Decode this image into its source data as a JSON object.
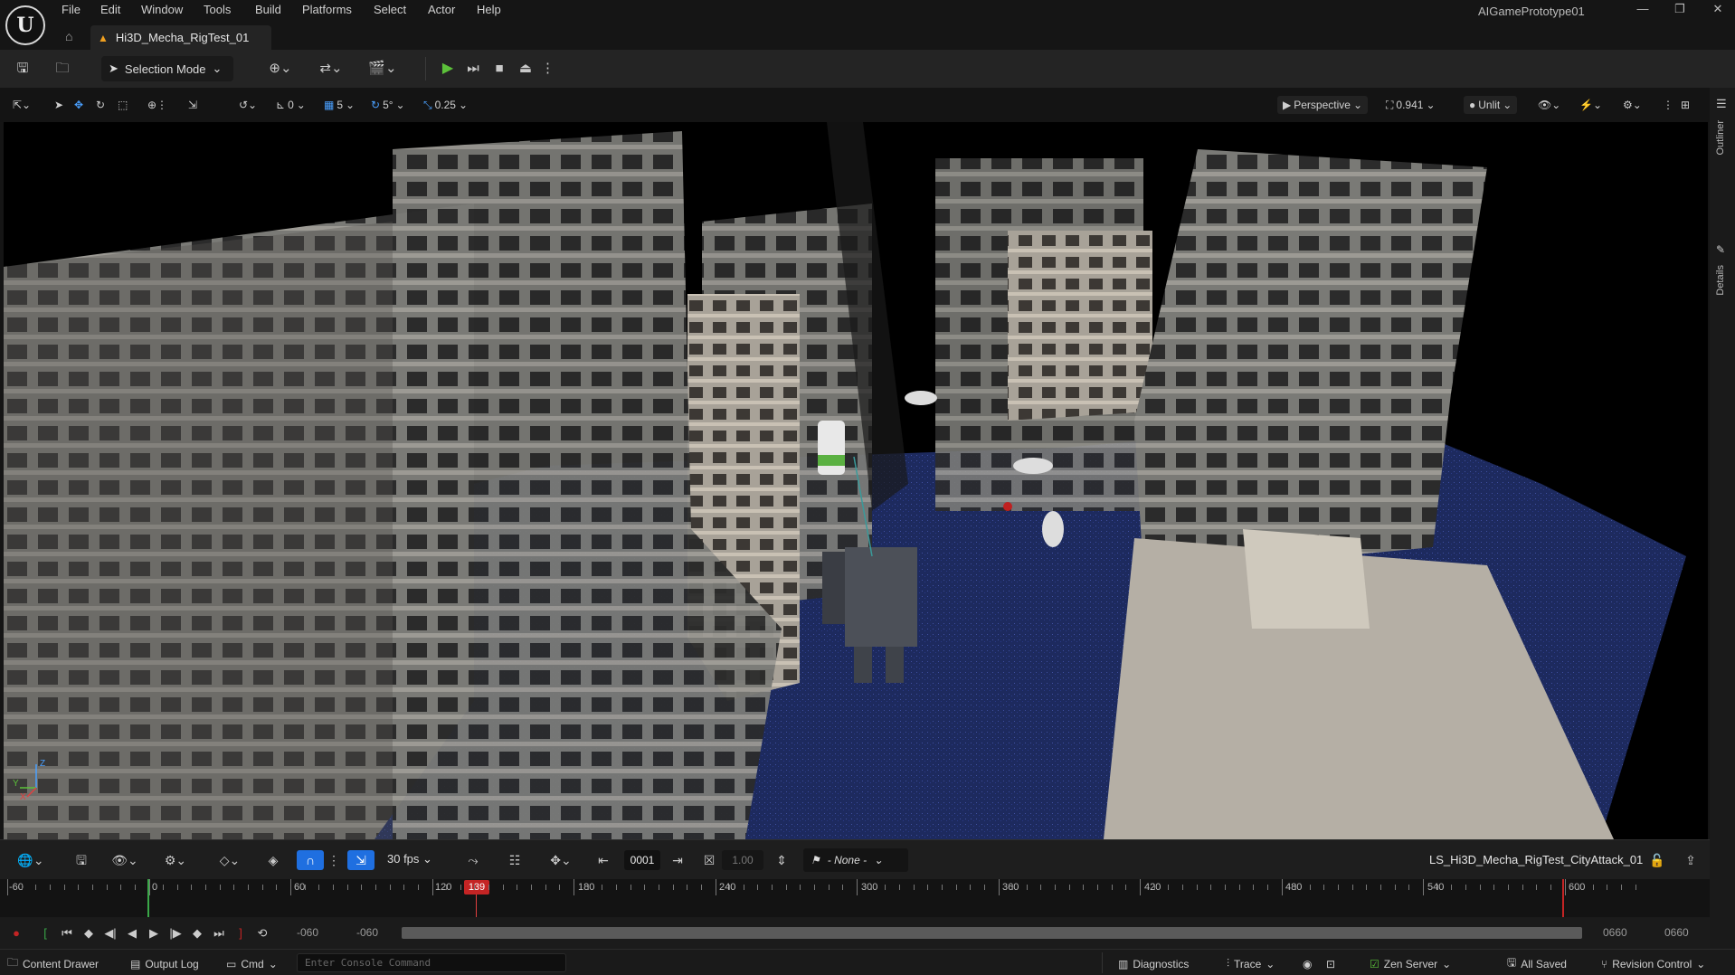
{
  "menu": [
    "File",
    "Edit",
    "Window",
    "Tools",
    "Build",
    "Platforms",
    "Select",
    "Actor",
    "Help"
  ],
  "project_name": "AIGamePrototype01",
  "level_tab": "Hi3D_Mecha_RigTest_01",
  "toolbar": {
    "selection_mode": "Selection Mode"
  },
  "viewport_toolbar": {
    "rotation_snap": "0",
    "grid_snap": "5",
    "angle_snap": "5°",
    "scale_snap": "0.25",
    "view_mode": "Perspective",
    "fov": "0.941",
    "lighting": "Unlit"
  },
  "sidebar_tabs": [
    "Outliner",
    "Details"
  ],
  "sequencer": {
    "fps": "30 fps",
    "current_frame": "0001",
    "speed": "1.00",
    "camera": "- None -",
    "sequence_name": "LS_Hi3D_Mecha_RigTest_CityAttack_01"
  },
  "timeline": {
    "labels": [
      "-60",
      "0",
      "60",
      "120",
      "180",
      "240",
      "300",
      "360",
      "420",
      "480",
      "540",
      "600"
    ],
    "playhead": "139",
    "range_start_a": "-060",
    "range_start_b": "-060",
    "range_end_a": "0660",
    "range_end_b": "0660"
  },
  "statusbar": {
    "content_drawer": "Content Drawer",
    "output_log": "Output Log",
    "cmd": "Cmd",
    "console_placeholder": "Enter Console Command",
    "diagnostics": "Diagnostics",
    "trace": "Trace",
    "zen_server": "Zen Server",
    "all_saved": "All Saved",
    "revision_control": "Revision Control"
  }
}
